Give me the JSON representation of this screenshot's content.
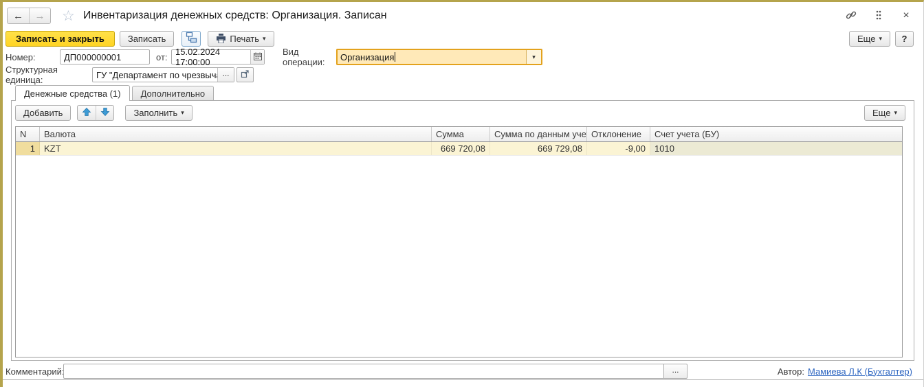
{
  "colors": {
    "frame": "#B5A44C",
    "accent_yellow": "#FFD424",
    "focus_border": "#E3A21D",
    "focus_fill": "#FFE9B8",
    "row_selected": "#FBF4D4",
    "cell_selected": "#F0DD9E",
    "row_selected_tail": "#ECEAD4",
    "link": "#2E66C1"
  },
  "window": {
    "title": "Инвентаризация денежных средств: Организация. Записан"
  },
  "icons": {
    "back": "←",
    "forward": "→",
    "star": "☆",
    "close": "×",
    "caret_down": "▾",
    "ellipsis": "...",
    "link_icon": "chain",
    "menu_icon": "vertical-dots",
    "post_icon": "related-documents",
    "print_icon": "printer",
    "calendar_icon": "calendar",
    "open_icon": "open-in-window",
    "up_icon": "arrow-up",
    "down_icon": "arrow-down"
  },
  "toolbar": {
    "save_close": "Записать и закрыть",
    "save": "Записать",
    "print": "Печать",
    "more": "Еще",
    "help": "?"
  },
  "fields": {
    "number_label": "Номер:",
    "number_value": "ДП000000001",
    "date_label": "от:",
    "date_value": "15.02.2024 17:00:00",
    "operation_label": "Вид операции:",
    "operation_value": "Организация",
    "unit_label": "Структурная единица:",
    "unit_value": "ГУ \"Департамент по чрезвычайным"
  },
  "tabs": {
    "cash": "Денежные средства (1)",
    "additional": "Дополнительно"
  },
  "table_toolbar": {
    "add": "Добавить",
    "fill": "Заполнить",
    "more": "Еще"
  },
  "table": {
    "columns": [
      "N",
      "Валюта",
      "Сумма",
      "Сумма по данным учета",
      "Отклонение",
      "Счет учета (БУ)"
    ],
    "rows": [
      {
        "n": "1",
        "currency": "KZT",
        "amount": "669 720,08",
        "amount_accounting": "669 729,08",
        "deviation": "-9,00",
        "account": "1010"
      }
    ]
  },
  "footer": {
    "comment_label": "Комментарий:",
    "comment_value": "",
    "author_label": "Автор:",
    "author_link": "Мамиева Л.К (Бухгалтер)"
  }
}
